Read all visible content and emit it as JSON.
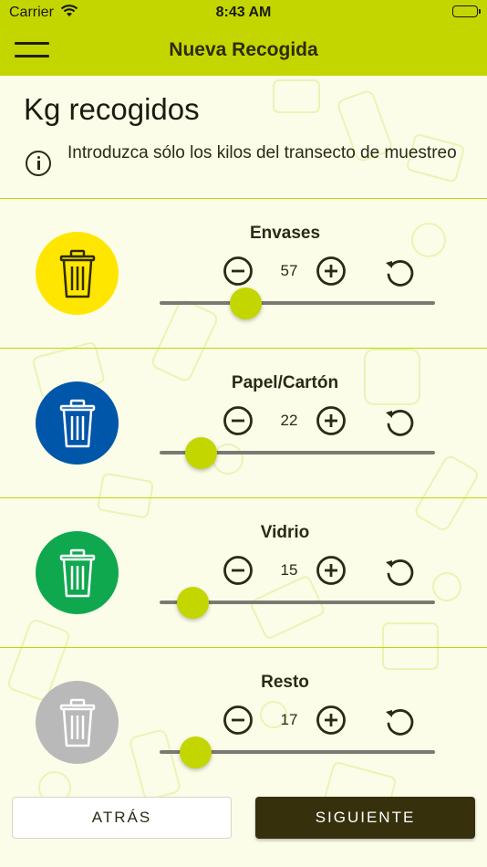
{
  "status_bar": {
    "carrier": "Carrier",
    "time": "8:43 AM"
  },
  "nav": {
    "title": "Nueva Recogida",
    "menu_icon": "hamburger-menu-icon"
  },
  "heading": "Kg recogidos",
  "info": {
    "icon": "info-icon",
    "text": "Introduzca sólo los kilos del transecto de muestreo"
  },
  "categories": [
    {
      "label": "Envases",
      "value": "57",
      "fraction": 0.31,
      "color": "#ffe600",
      "icon_color": "#2e2a00"
    },
    {
      "label": "Papel/Cartón",
      "value": "22",
      "fraction": 0.15,
      "color": "#0056a8",
      "icon_color": "#ffffff"
    },
    {
      "label": "Vidrio",
      "value": "15",
      "fraction": 0.12,
      "color": "#10a84f",
      "icon_color": "#ffffff"
    },
    {
      "label": "Resto",
      "value": "17",
      "fraction": 0.13,
      "color": "#b9b9b9",
      "icon_color": "#ffffff"
    }
  ],
  "buttons": {
    "back": "ATRÁS",
    "next": "SIGUIENTE"
  },
  "colors": {
    "accent": "#c4d600",
    "dark": "#36300c"
  }
}
